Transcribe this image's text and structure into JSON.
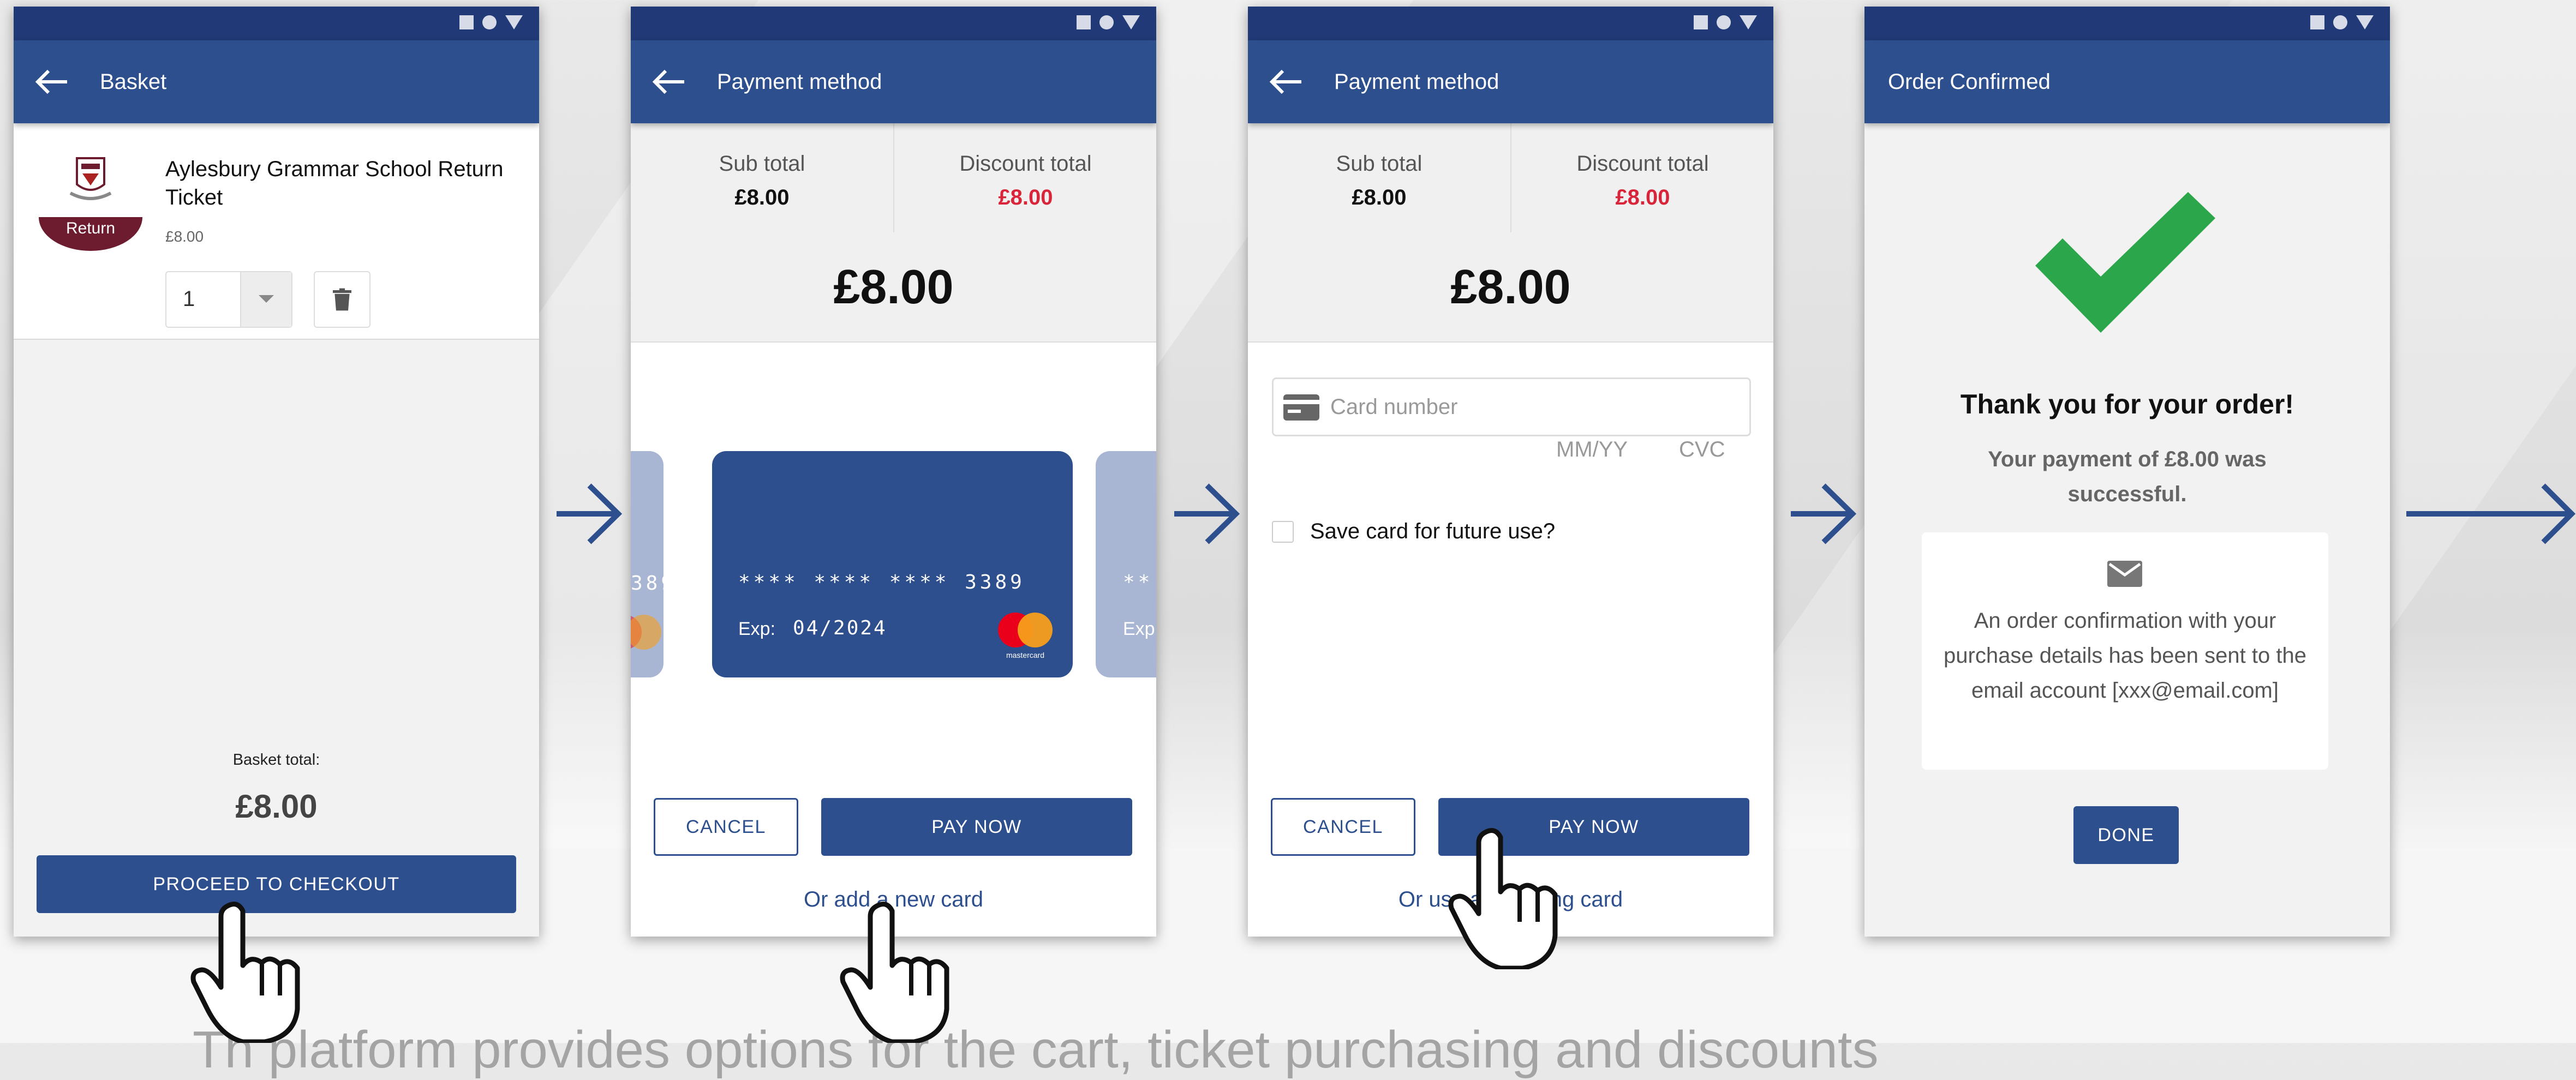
{
  "colors": {
    "primary": "#2d4f8e",
    "statusbar": "#213a77",
    "discount_red": "#d9253a",
    "success_green": "#2ca64a"
  },
  "screen1": {
    "title": "Basket",
    "item": {
      "name": "Aylesbury Grammar School Return Ticket",
      "price": "£8.00",
      "badge": "Return",
      "quantity": "1"
    },
    "total_label": "Basket total:",
    "total_value": "£8.00",
    "checkout_label": "PROCEED TO CHECKOUT"
  },
  "screen2": {
    "title": "Payment method",
    "subtotal_label": "Sub total",
    "subtotal_value": "£8.00",
    "discount_label": "Discount total",
    "discount_value": "£8.00",
    "amount": "£8.00",
    "card": {
      "number": "****  ****  ****  3389",
      "exp_label": "Exp:",
      "exp": "04/2024",
      "brand": "mastercard"
    },
    "prev_card": {
      "number_tail": "389"
    },
    "next_card": {
      "number_head": "**",
      "exp_label": "Exp"
    },
    "cancel_label": "CANCEL",
    "pay_label": "PAY NOW",
    "link_label": "Or add a new card"
  },
  "screen3": {
    "title": "Payment method",
    "subtotal_label": "Sub total",
    "subtotal_value": "£8.00",
    "discount_label": "Discount total",
    "discount_value": "£8.00",
    "amount": "£8.00",
    "card_placeholder": "Card number",
    "mmyy_placeholder": "MM/YY",
    "cvc_placeholder": "CVC",
    "save_card_label": "Save card for future use?",
    "cancel_label": "CANCEL",
    "pay_label": "PAY NOW",
    "link_label": "Or use an existing card"
  },
  "screen4": {
    "title": "Order Confirmed",
    "thanks": "Thank you for your order!",
    "payment_msg": "Your payment of £8.00 was successful.",
    "email_msg": "An order confirmation with your purchase details has been sent to the email account [xxx@email.com]",
    "done_label": "DONE"
  },
  "caption": "Th                  platform provides options for the cart, ticket purchasing and discounts"
}
